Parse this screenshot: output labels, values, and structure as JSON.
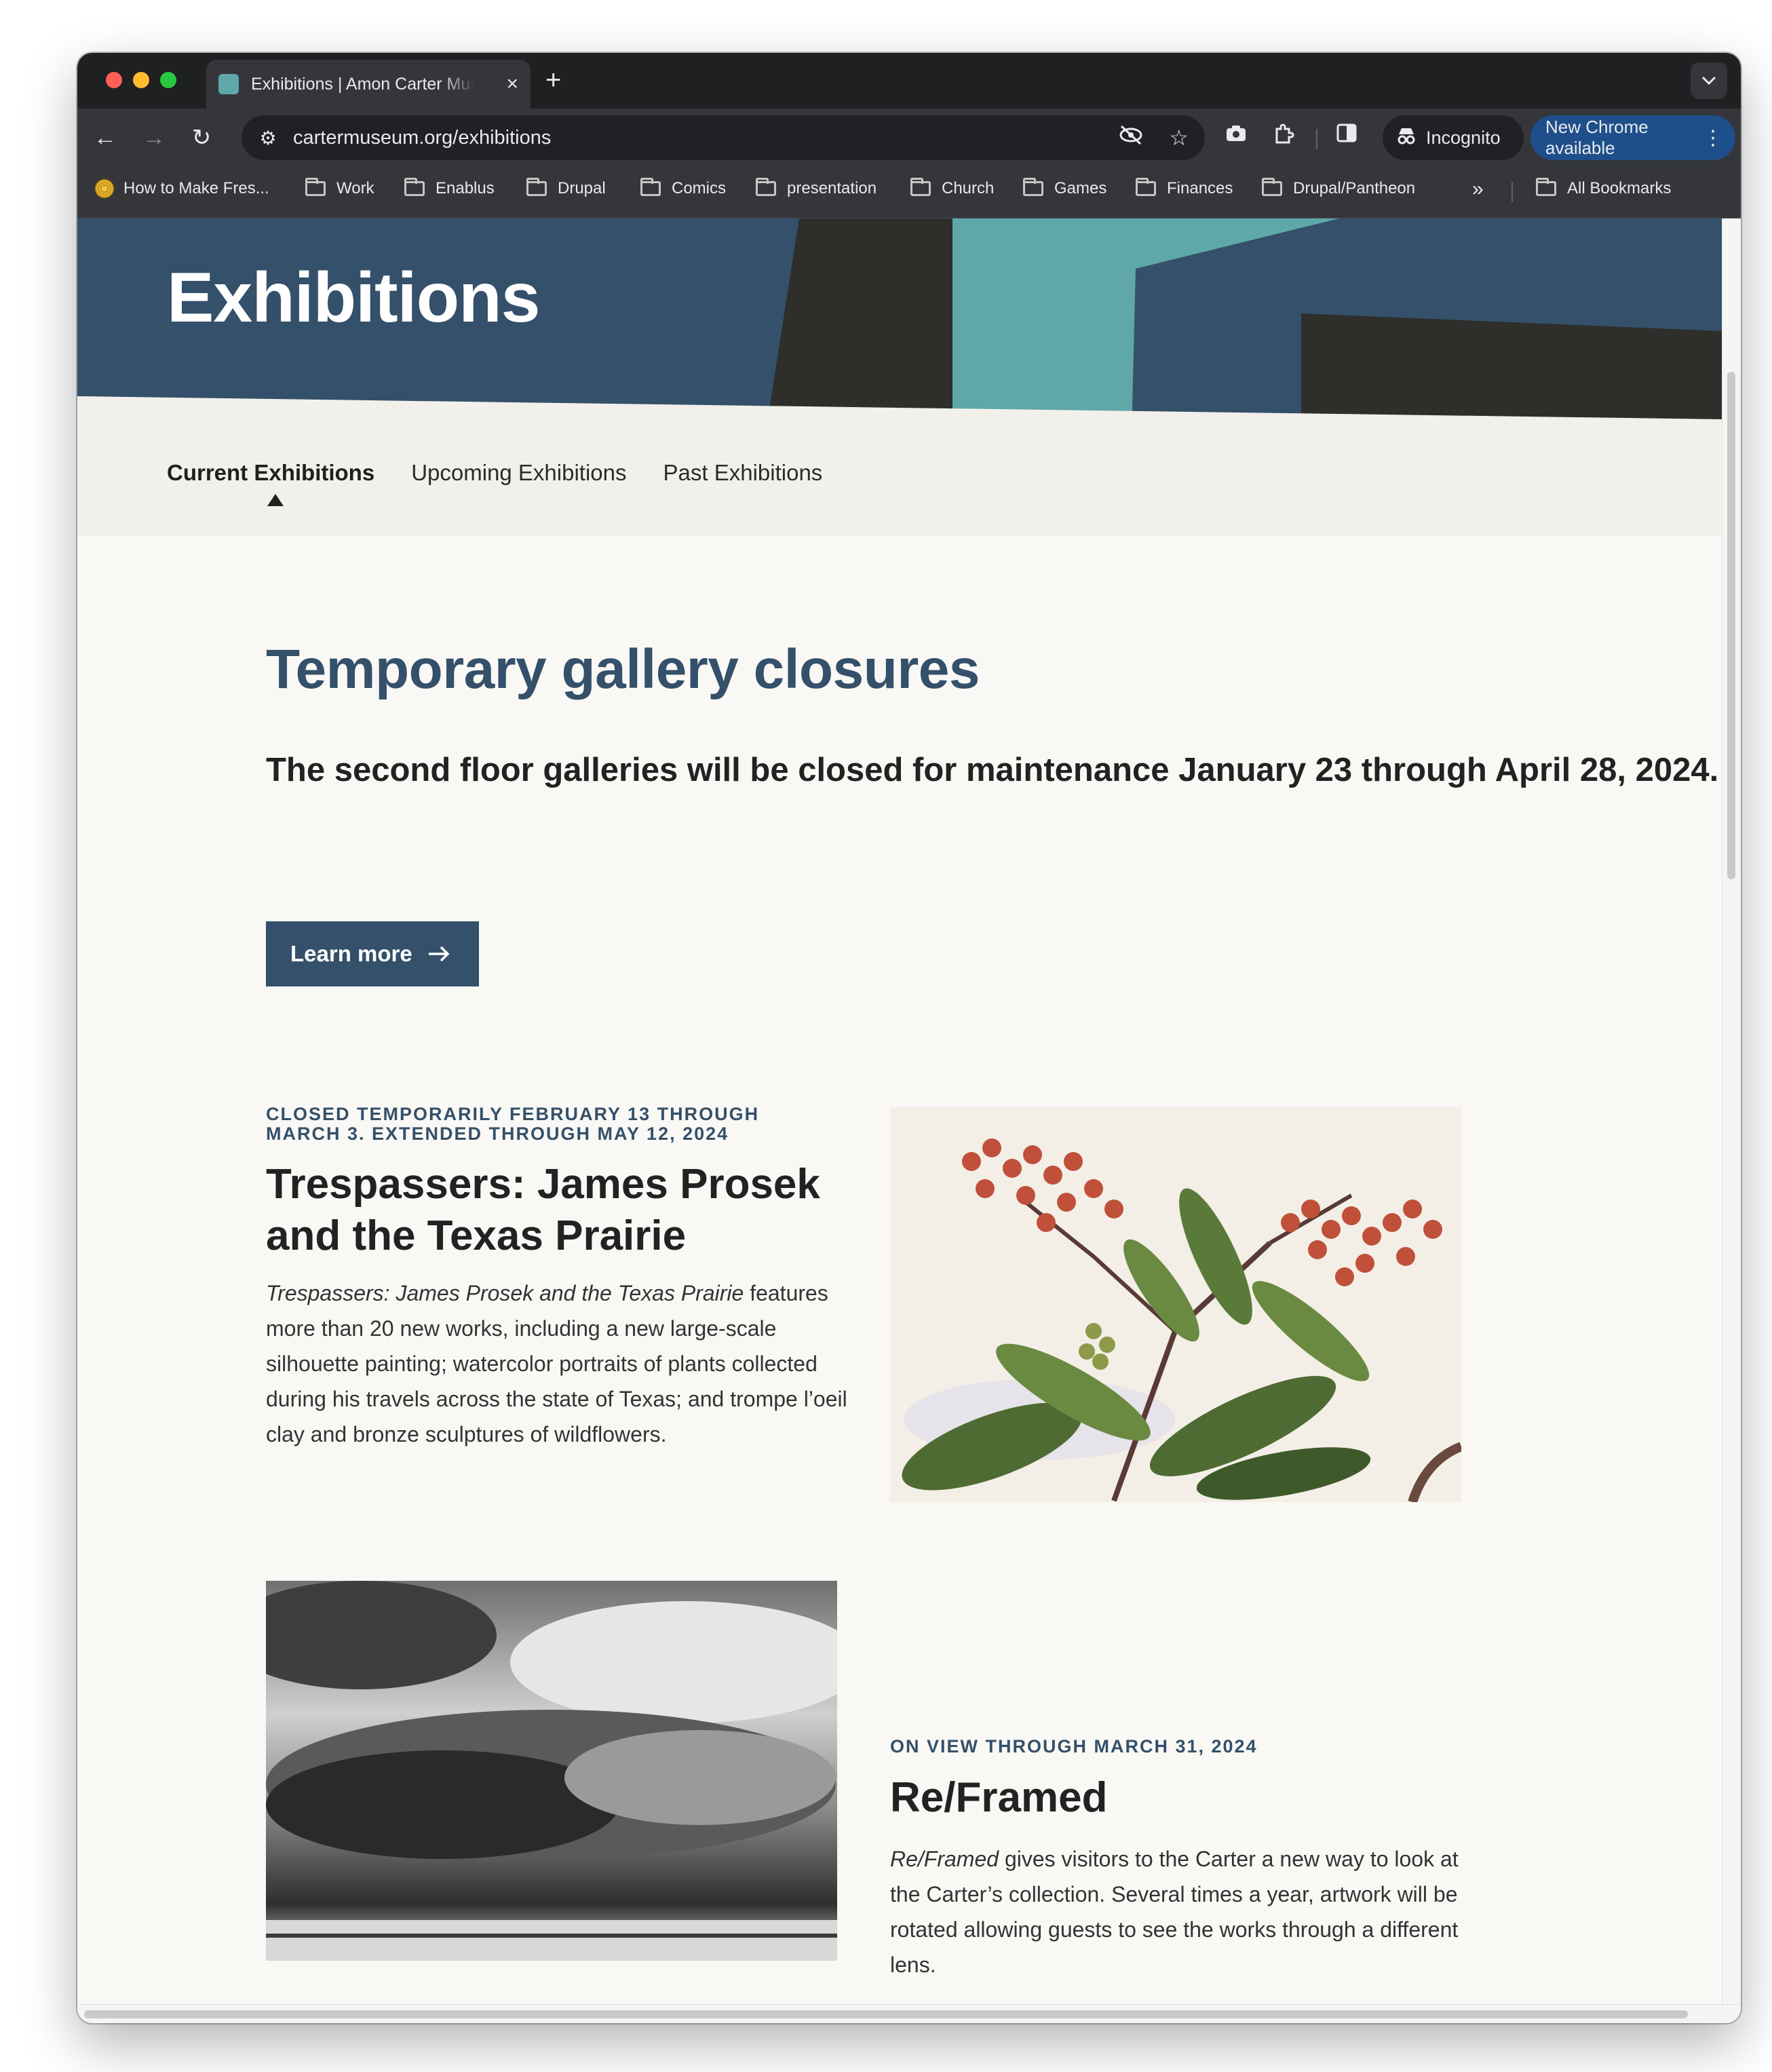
{
  "browser": {
    "tab_title": "Exhibitions | Amon Carter Museum",
    "tab_close": "×",
    "new_tab": "+",
    "url": "cartermuseum.org/exhibitions",
    "incognito_label": "Incognito",
    "new_chrome_label": "New Chrome available",
    "bookmarks": [
      {
        "label": "How to Make Fres...",
        "icon": "spiral-favicon"
      },
      {
        "label": "Work",
        "icon": "folder-icon"
      },
      {
        "label": "Enablus",
        "icon": "folder-icon"
      },
      {
        "label": "Drupal",
        "icon": "folder-icon"
      },
      {
        "label": "Comics",
        "icon": "folder-icon"
      },
      {
        "label": "presentation",
        "icon": "folder-icon"
      },
      {
        "label": "Church",
        "icon": "folder-icon"
      },
      {
        "label": "Games",
        "icon": "folder-icon"
      },
      {
        "label": "Finances",
        "icon": "folder-icon"
      },
      {
        "label": "Drupal/Pantheon",
        "icon": "folder-icon"
      }
    ],
    "bookmarks_overflow": "»",
    "all_bookmarks": "All Bookmarks"
  },
  "hero": {
    "title": "Exhibitions",
    "colors": {
      "navy": "#34506a",
      "dark": "#2e2e2b",
      "teal": "#5fa7a8"
    }
  },
  "subnav": {
    "items": [
      {
        "label": "Current Exhibitions",
        "active": true
      },
      {
        "label": "Upcoming Exhibitions",
        "active": false
      },
      {
        "label": "Past Exhibitions",
        "active": false
      }
    ]
  },
  "notice": {
    "heading": "Temporary gallery closures",
    "text": "The second floor galleries will be closed for maintenance January 23 through April 28, 2024.",
    "button_label": "Learn more",
    "button_icon": "arrow-right-icon"
  },
  "exhibitions": [
    {
      "eyebrow": "CLOSED TEMPORARILY FEBRUARY 13 THROUGH MARCH 3. EXTENDED THROUGH MAY 12, 2024",
      "title": "Trespassers: James Prosek and the Texas Prairie",
      "desc_italic": "Trespassers: James Prosek and the Texas Prairie",
      "desc_rest": " features more than 20 new works, including a new large-scale silhouette painting; watercolor portraits of plants collected during his travels across the state of Texas; and trompe l’oeil clay and bronze sculptures of wildflowers.",
      "image": "botanical-watercolor-milkweed"
    },
    {
      "eyebrow": "ON VIEW THROUGH MARCH 31, 2024",
      "title": "Re/Framed",
      "desc_italic": "Re/Framed",
      "desc_rest": " gives visitors to the Carter a new way to look at the Carter’s collection. Several times a year, artwork will be rotated allowing guests to see the works through a different lens.",
      "image": "black-and-white-storm-clouds-photo"
    }
  ]
}
